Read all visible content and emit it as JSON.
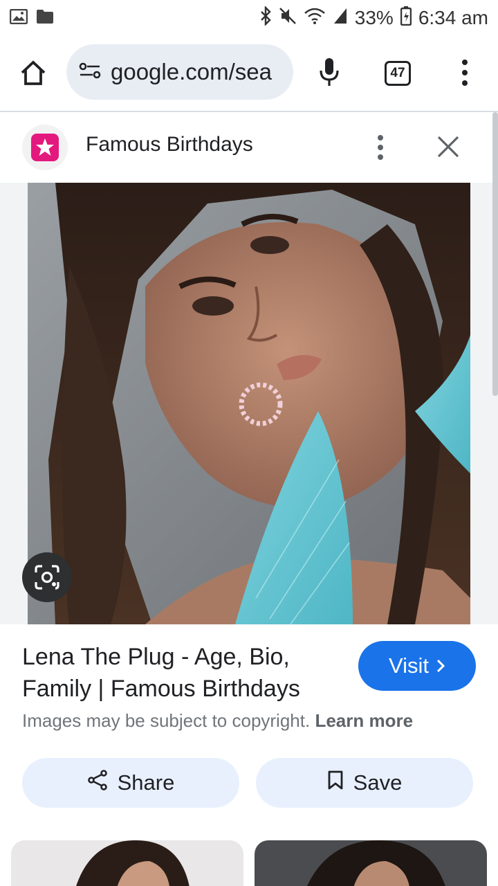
{
  "status_bar": {
    "battery": "33%",
    "time": "6:34 am"
  },
  "browser": {
    "url": "google.com/sea",
    "tab_count": "47"
  },
  "source": {
    "name": "Famous Birthdays"
  },
  "result": {
    "title": "Lena The Plug - Age, Bio, Family | Famous Birthdays",
    "visit_label": "Visit",
    "copyright_text": "Images may be subject to copyright.",
    "learn_more": "Learn more",
    "share_label": "Share",
    "save_label": "Save"
  },
  "icons": {
    "status_left": [
      "gallery-icon",
      "folder-icon"
    ],
    "status_right": [
      "bluetooth-icon",
      "mute-icon",
      "wifi-icon",
      "signal-icon",
      "battery-icon"
    ],
    "toolbar": [
      "home-icon",
      "site-info-icon",
      "mic-icon",
      "tabs-icon",
      "menu-icon"
    ],
    "source": [
      "famous-birthdays-logo",
      "more-vert-icon",
      "close-icon"
    ],
    "image": [
      "lens-icon"
    ],
    "actions": [
      "share-icon",
      "bookmark-icon",
      "chevron-right-icon"
    ]
  },
  "colors": {
    "accent": "#1a73e8",
    "pill_background": "#e8f0fe",
    "url_background": "#e8edf4",
    "brand_pink": "#e4197e"
  }
}
